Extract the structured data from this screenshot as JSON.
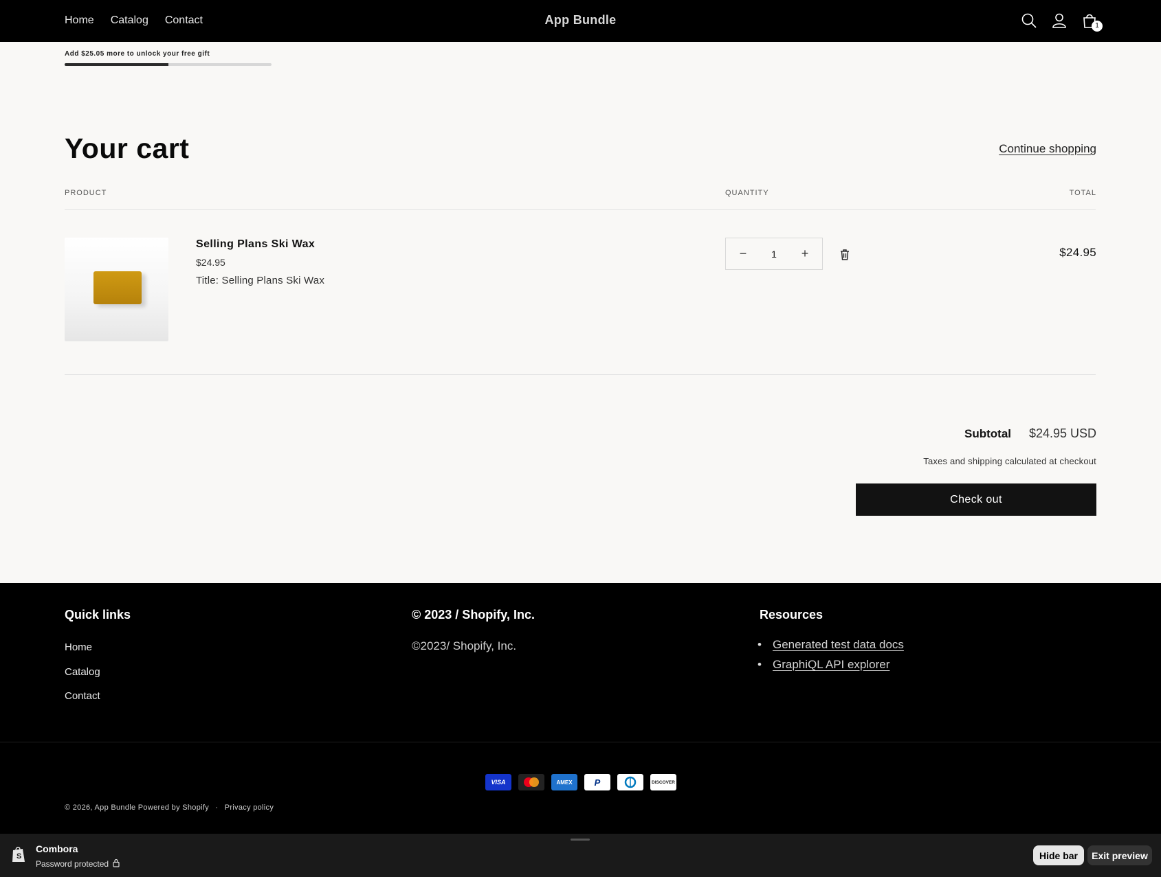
{
  "header": {
    "nav": [
      "Home",
      "Catalog",
      "Contact"
    ],
    "brand": "App Bundle",
    "cart_count": "1"
  },
  "gift": {
    "message": "Add $25.05 more to unlock your free gift",
    "progress": 0.5
  },
  "cart": {
    "title": "Your cart",
    "continue_label": "Continue shopping",
    "columns": {
      "product": "PRODUCT",
      "quantity": "QUANTITY",
      "total": "TOTAL"
    },
    "items": [
      {
        "name": "Selling Plans Ski Wax",
        "price": "$24.95",
        "option": "Title: Selling Plans Ski Wax",
        "quantity": "1",
        "line_total": "$24.95"
      }
    ],
    "subtotal_label": "Subtotal",
    "subtotal_value": "$24.95 USD",
    "tax_note": "Taxes and shipping calculated at checkout",
    "checkout_label": "Check out"
  },
  "footer": {
    "quick_links_heading": "Quick links",
    "quick_links": [
      "Home",
      "Catalog",
      "Contact"
    ],
    "copyright_heading": "© 2023 / Shopify, Inc.",
    "copyright_text": "©2023/ Shopify, Inc.",
    "resources_heading": "Resources",
    "resources": [
      "Generated test data docs",
      "GraphiQL API explorer"
    ],
    "payment_methods": [
      "VISA",
      "MC",
      "AMEX",
      "P",
      "D",
      "DISCOVER"
    ],
    "bottom_copyright": "© 2026, App Bundle",
    "powered_by": "Powered by Shopify",
    "privacy": "Privacy policy",
    "separator": "·"
  },
  "preview_bar": {
    "store_name": "Combora",
    "status": "Password protected",
    "hide_label": "Hide bar",
    "exit_label": "Exit preview"
  }
}
